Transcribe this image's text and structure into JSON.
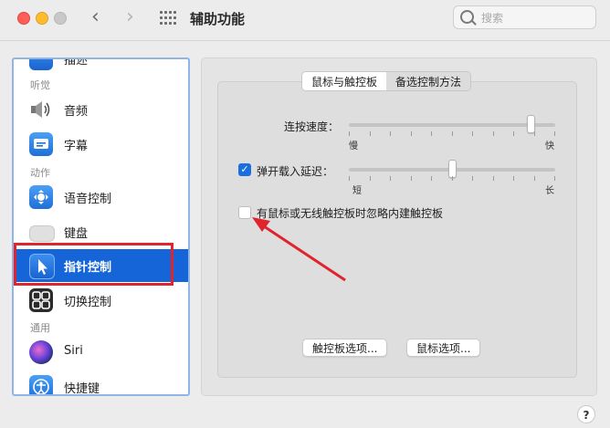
{
  "window": {
    "title": "辅助功能"
  },
  "search": {
    "placeholder": "搜索"
  },
  "sidebar": {
    "partial_top": "描述",
    "sections": {
      "hearing": "听觉",
      "motor": "动作",
      "general": "通用"
    },
    "items": [
      {
        "label": "音频",
        "icon": "speaker-icon"
      },
      {
        "label": "字幕",
        "icon": "captions-icon"
      },
      {
        "label": "语音控制",
        "icon": "voice-control-icon"
      },
      {
        "label": "键盘",
        "icon": "keyboard-icon"
      },
      {
        "label": "指针控制",
        "icon": "pointer-icon",
        "selected": true
      },
      {
        "label": "切换控制",
        "icon": "switch-control-icon"
      },
      {
        "label": "Siri",
        "icon": "siri-icon"
      },
      {
        "label": "快捷键",
        "icon": "accessibility-icon"
      }
    ]
  },
  "tabs": [
    {
      "label": "鼠标与触控板",
      "active": true
    },
    {
      "label": "备选控制方法",
      "active": false
    }
  ],
  "double_click_speed": {
    "label": "连按速度：",
    "min": "慢",
    "max": "快",
    "value_fraction": 0.9
  },
  "spring_loading": {
    "label": "弹开载入延迟：",
    "checked": true,
    "min": "短",
    "max": "长",
    "value_fraction": 0.5
  },
  "ignore_trackpad": {
    "label": "有鼠标或无线触控板时忽略内建触控板",
    "checked": false
  },
  "buttons": {
    "trackpad_options": "触控板选项...",
    "mouse_options": "鼠标选项..."
  },
  "help": "?",
  "colors": {
    "accent": "#1565d8",
    "highlight_frame": "#e0242e",
    "arrow": "#e0242e"
  }
}
